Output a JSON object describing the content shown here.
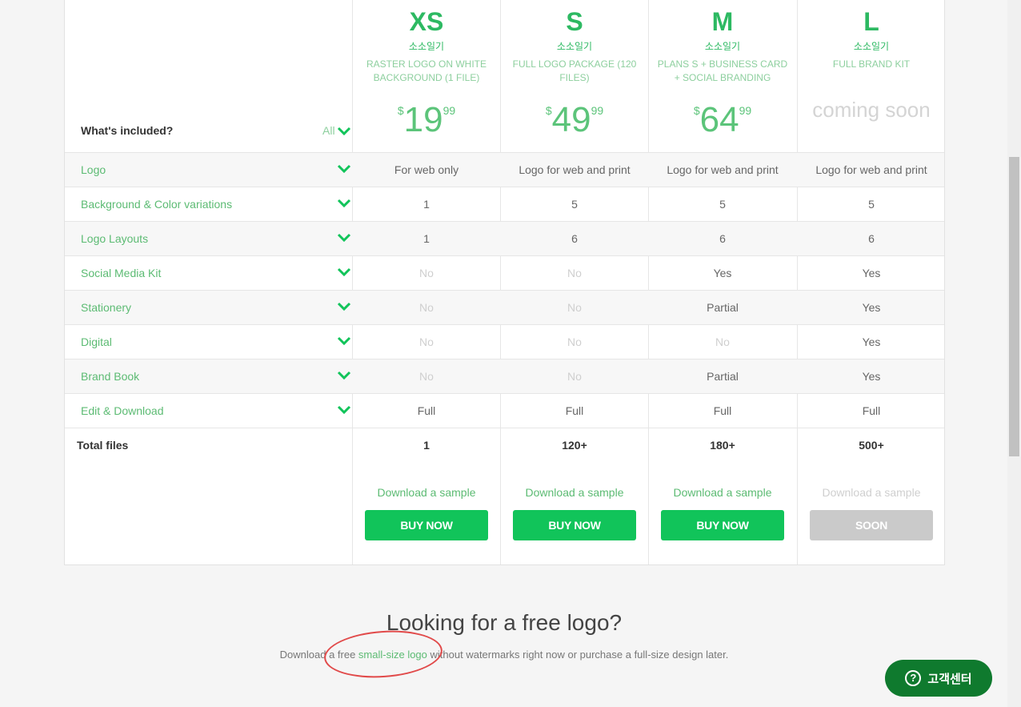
{
  "header": {
    "whats_included": "What's included?",
    "all_label": "All"
  },
  "plans": [
    {
      "tier": "XS",
      "korean": "소소일기",
      "desc": "RASTER LOGO ON WHITE BACKGROUND (1 FILE)",
      "currency": "$",
      "price_int": "19",
      "price_cents": "99",
      "coming_soon": "",
      "total": "1",
      "sample": "Download a sample",
      "button": "BUY NOW"
    },
    {
      "tier": "S",
      "korean": "소소일기",
      "desc": "FULL LOGO PACKAGE (120 FILES)",
      "currency": "$",
      "price_int": "49",
      "price_cents": "99",
      "coming_soon": "",
      "total": "120+",
      "sample": "Download a sample",
      "button": "BUY NOW"
    },
    {
      "tier": "M",
      "korean": "소소일기",
      "desc": "PLANS S + BUSINESS CARD + SOCIAL BRANDING",
      "currency": "$",
      "price_int": "64",
      "price_cents": "99",
      "coming_soon": "",
      "total": "180+",
      "sample": "Download a sample",
      "button": "BUY NOW"
    },
    {
      "tier": "L",
      "korean": "소소일기",
      "desc": "FULL BRAND KIT",
      "currency": "",
      "price_int": "",
      "price_cents": "",
      "coming_soon": "coming soon",
      "total": "500+",
      "sample": "Download a sample",
      "button": "SOON"
    }
  ],
  "features": [
    {
      "label": "Logo",
      "values": [
        "For web only",
        "Logo for web and print",
        "Logo for web and print",
        "Logo for web and print"
      ]
    },
    {
      "label": "Background & Color variations",
      "values": [
        "1",
        "5",
        "5",
        "5"
      ]
    },
    {
      "label": "Logo Layouts",
      "values": [
        "1",
        "6",
        "6",
        "6"
      ]
    },
    {
      "label": "Social Media Kit",
      "values": [
        "No",
        "No",
        "Yes",
        "Yes"
      ]
    },
    {
      "label": "Stationery",
      "values": [
        "No",
        "No",
        "Partial",
        "Yes"
      ]
    },
    {
      "label": "Digital",
      "values": [
        "No",
        "No",
        "No",
        "Yes"
      ]
    },
    {
      "label": "Brand Book",
      "values": [
        "No",
        "No",
        "Partial",
        "Yes"
      ]
    },
    {
      "label": "Edit & Download",
      "values": [
        "Full",
        "Full",
        "Full",
        "Full"
      ]
    }
  ],
  "total_label": "Total files",
  "free_section": {
    "title": "Looking for a free logo?",
    "text_before": "Download a free ",
    "link": "small-size logo",
    "text_after": " without watermarks right now or purchase a full-size design later."
  },
  "help_button": {
    "icon": "question-icon",
    "label": "고객센터"
  },
  "colors": {
    "accent": "#11c45a",
    "text_green": "#5cbb73",
    "disabled": "#cacaca",
    "help_bg": "#0f7a2e",
    "annotation": "#e14a4a"
  }
}
